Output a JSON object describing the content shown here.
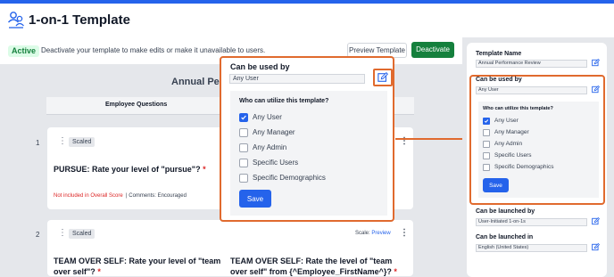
{
  "header": {
    "title": "1-on-1 Template"
  },
  "status": {
    "badge": "Active",
    "text": "Deactivate your template to make edits or make it unavailable to users.",
    "preview_label": "Preview Template",
    "deactivate_label": "Deactivate"
  },
  "main": {
    "sheet_title": "Annual Per",
    "tab_label": "Employee Questions",
    "questions": [
      {
        "number": "1",
        "type": "Scaled",
        "text": "PURSUE: Rate your level of \"pursue\"?",
        "required": "*",
        "note_red": "Not included in Overall Score",
        "note_gray": "Comments: Encouraged"
      },
      {
        "number": "2",
        "type": "Scaled",
        "text_left": "TEAM OVER SELF: Rate your level of \"team over self\"?",
        "text_right": "TEAM OVER SELF: Rate the level of \"team over self\" from {^Employee_FirstName^}?",
        "required": "*",
        "scale_label": "Scale:",
        "scale_link": "Preview"
      }
    ]
  },
  "popup": {
    "title": "Can be used by",
    "value": "Any User",
    "question": "Who can utilize this template?",
    "options": [
      {
        "label": "Any User",
        "checked": true
      },
      {
        "label": "Any Manager",
        "checked": false
      },
      {
        "label": "Any Admin",
        "checked": false
      },
      {
        "label": "Specific Users",
        "checked": false
      },
      {
        "label": "Specific Demographics",
        "checked": false
      }
    ],
    "save_label": "Save"
  },
  "right_panel": {
    "template_name_label": "Template Name",
    "template_name_value": "Annual Performance Review",
    "used_by_label": "Can be used by",
    "used_by_value": "Any User",
    "question": "Who can utilize this template?",
    "options": [
      {
        "label": "Any User",
        "checked": true
      },
      {
        "label": "Any Manager",
        "checked": false
      },
      {
        "label": "Any Admin",
        "checked": false
      },
      {
        "label": "Specific Users",
        "checked": false
      },
      {
        "label": "Specific Demographics",
        "checked": false
      }
    ],
    "save_label": "Save",
    "launched_by_label": "Can be launched by",
    "launched_by_value": "User-Initiated 1-on-1s",
    "launched_in_label": "Can be launched in",
    "launched_in_value": "English (United States)"
  },
  "colors": {
    "accent": "#2563eb",
    "highlight": "#e06a2e",
    "active_green": "#15803d"
  }
}
